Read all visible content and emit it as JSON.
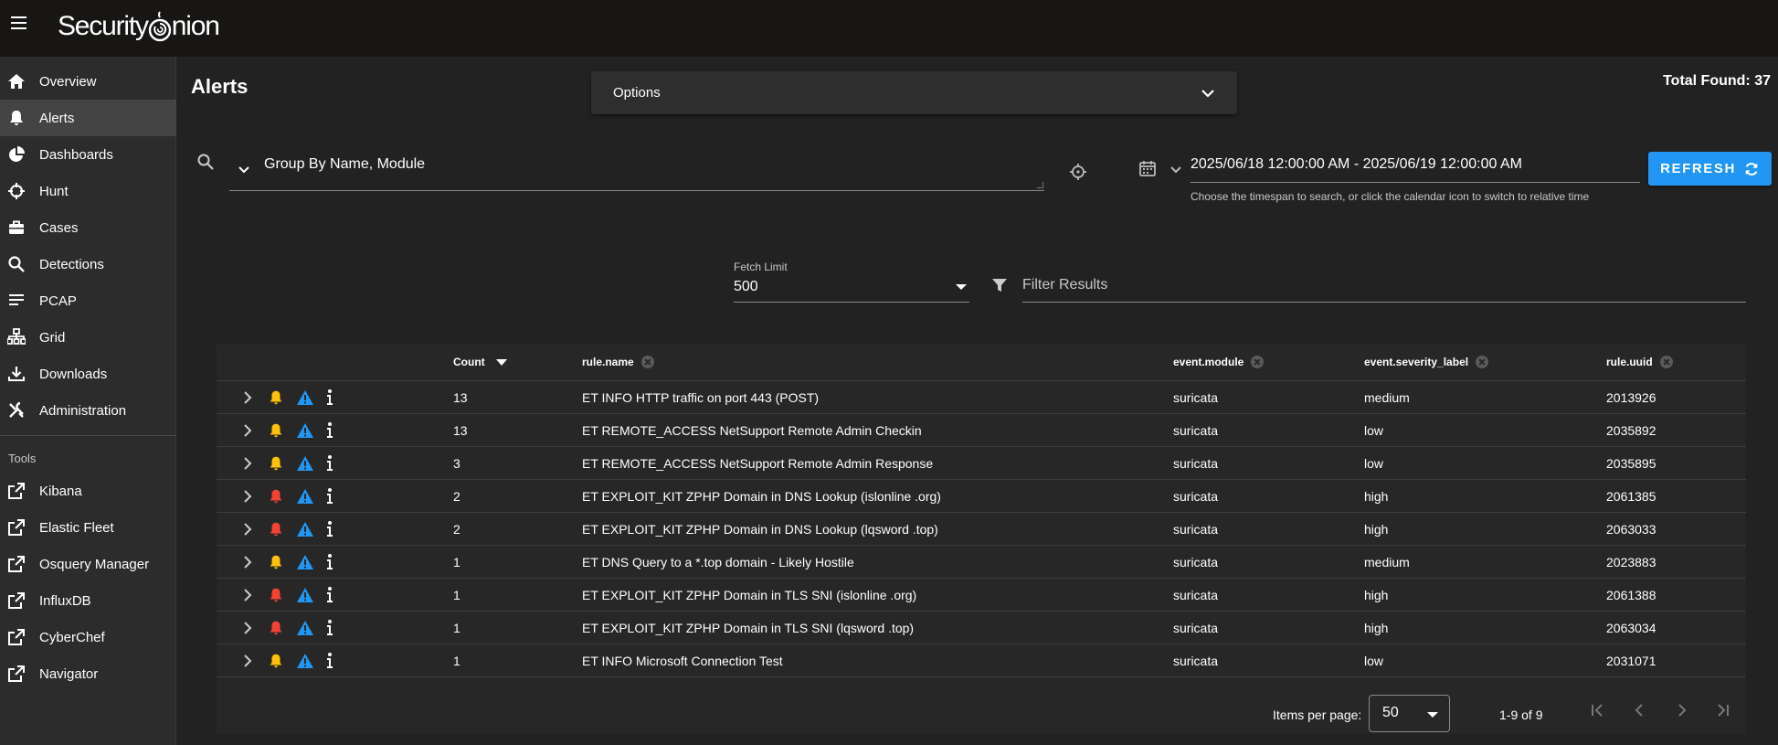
{
  "app": {
    "logo_text_1": "Security",
    "logo_text_2": "nion"
  },
  "sidebar": {
    "items": [
      {
        "label": "Overview",
        "icon": "home-icon"
      },
      {
        "label": "Alerts",
        "icon": "bell-icon",
        "active": true
      },
      {
        "label": "Dashboards",
        "icon": "pie-chart-icon"
      },
      {
        "label": "Hunt",
        "icon": "crosshairs-icon"
      },
      {
        "label": "Cases",
        "icon": "briefcase-icon"
      },
      {
        "label": "Detections",
        "icon": "search-icon"
      },
      {
        "label": "PCAP",
        "icon": "list-icon"
      },
      {
        "label": "Grid",
        "icon": "network-icon"
      },
      {
        "label": "Downloads",
        "icon": "download-icon"
      },
      {
        "label": "Administration",
        "icon": "tools-icon"
      }
    ],
    "tools_heading": "Tools",
    "tools": [
      {
        "label": "Kibana",
        "icon": "external-link-icon"
      },
      {
        "label": "Elastic Fleet",
        "icon": "external-link-icon"
      },
      {
        "label": "Osquery Manager",
        "icon": "external-link-icon"
      },
      {
        "label": "InfluxDB",
        "icon": "external-link-icon"
      },
      {
        "label": "CyberChef",
        "icon": "external-link-icon"
      },
      {
        "label": "Navigator",
        "icon": "external-link-icon"
      }
    ]
  },
  "main": {
    "title": "Alerts",
    "options_label": "Options",
    "total_found": "Total Found: 37",
    "query": "Group By Name, Module",
    "date_range": "2025/06/18 12:00:00 AM - 2025/06/19 12:00:00 AM",
    "date_hint": "Choose the timespan to search, or click the calendar icon to switch to relative time",
    "refresh_label": "REFRESH",
    "fetch_limit_label": "Fetch Limit",
    "fetch_limit_value": "500",
    "filter_placeholder": "Filter Results"
  },
  "table": {
    "columns": [
      "Count",
      "rule.name",
      "event.module",
      "event.severity_label",
      "rule.uuid"
    ],
    "rows": [
      {
        "count": "13",
        "rule_name": "ET INFO HTTP traffic on port 443 (POST)",
        "module": "suricata",
        "severity": "medium",
        "uuid": "2013926",
        "bell": "yellow"
      },
      {
        "count": "13",
        "rule_name": "ET REMOTE_ACCESS NetSupport Remote Admin Checkin",
        "module": "suricata",
        "severity": "low",
        "uuid": "2035892",
        "bell": "yellow"
      },
      {
        "count": "3",
        "rule_name": "ET REMOTE_ACCESS NetSupport Remote Admin Response",
        "module": "suricata",
        "severity": "low",
        "uuid": "2035895",
        "bell": "yellow"
      },
      {
        "count": "2",
        "rule_name": "ET EXPLOIT_KIT ZPHP Domain in DNS Lookup (islonline .org)",
        "module": "suricata",
        "severity": "high",
        "uuid": "2061385",
        "bell": "red"
      },
      {
        "count": "2",
        "rule_name": "ET EXPLOIT_KIT ZPHP Domain in DNS Lookup (lqsword .top)",
        "module": "suricata",
        "severity": "high",
        "uuid": "2063033",
        "bell": "red"
      },
      {
        "count": "1",
        "rule_name": "ET DNS Query to a *.top domain - Likely Hostile",
        "module": "suricata",
        "severity": "medium",
        "uuid": "2023883",
        "bell": "yellow"
      },
      {
        "count": "1",
        "rule_name": "ET EXPLOIT_KIT ZPHP Domain in TLS SNI (islonline .org)",
        "module": "suricata",
        "severity": "high",
        "uuid": "2061388",
        "bell": "red"
      },
      {
        "count": "1",
        "rule_name": "ET EXPLOIT_KIT ZPHP Domain in TLS SNI (lqsword .top)",
        "module": "suricata",
        "severity": "high",
        "uuid": "2063034",
        "bell": "red"
      },
      {
        "count": "1",
        "rule_name": "ET INFO Microsoft Connection Test",
        "module": "suricata",
        "severity": "low",
        "uuid": "2031071",
        "bell": "yellow"
      }
    ],
    "items_per_page_label": "Items per page:",
    "items_per_page": "50",
    "range_text": "1-9 of 9"
  },
  "colors": {
    "accent": "#2196f3",
    "bell_yellow": "#ffc107",
    "bell_red": "#f44336",
    "warn_blue": "#2196f3"
  }
}
